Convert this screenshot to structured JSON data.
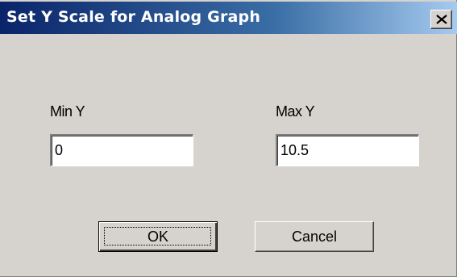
{
  "window": {
    "title": "Set Y Scale for Analog Graph",
    "close_icon": "close-icon"
  },
  "form": {
    "min_label": "Min Y",
    "min_value": "0",
    "max_label": "Max Y",
    "max_value": "10.5"
  },
  "buttons": {
    "ok_label": "OK",
    "cancel_label": "Cancel"
  },
  "colors": {
    "title_start": "#0a246a",
    "title_end": "#a6caf0",
    "dialog_face": "#d6d3ce"
  }
}
